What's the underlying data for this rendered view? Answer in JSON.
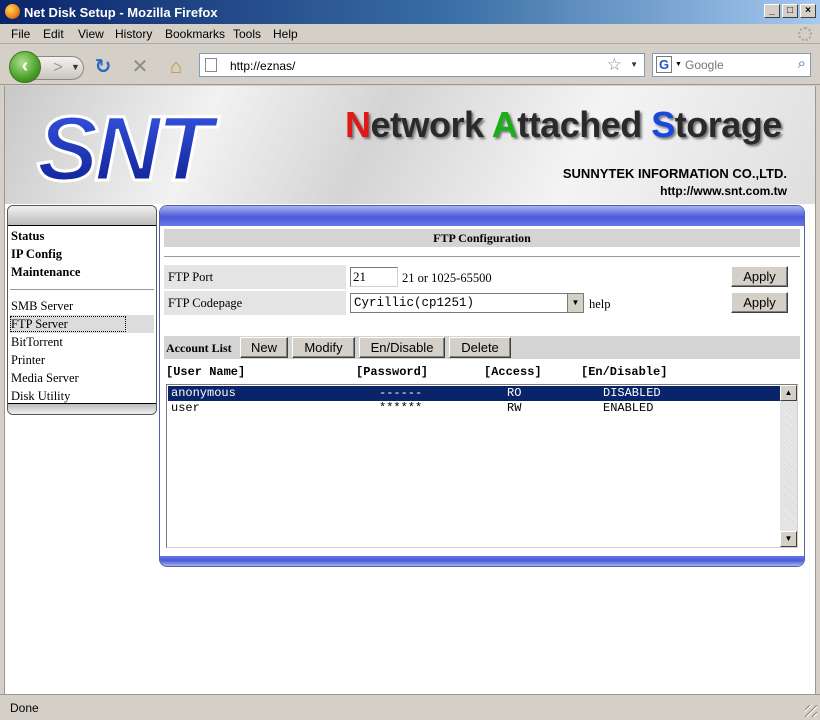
{
  "window": {
    "title": "Net Disk Setup - Mozilla Firefox"
  },
  "menubar": [
    "File",
    "Edit",
    "View",
    "History",
    "Bookmarks",
    "Tools",
    "Help"
  ],
  "navigation": {
    "url": "http://eznas/",
    "search_placeholder": "Google"
  },
  "banner": {
    "logo_text": "SNT",
    "heading": [
      "N",
      "etwork ",
      "A",
      "ttached ",
      "S",
      "torage"
    ],
    "company": "SUNNYTEK INFORMATION CO.,LTD.",
    "website": "http://www.snt.com.tw"
  },
  "sidebar": {
    "main_items": [
      "Status",
      "IP Config",
      "Maintenance"
    ],
    "service_items": [
      "SMB Server",
      "FTP Server",
      "BitTorrent",
      "Printer",
      "Media Server",
      "Disk Utility"
    ],
    "selected": "FTP Server"
  },
  "ftp": {
    "section_title": "FTP Configuration",
    "port_label": "FTP Port",
    "port_value": "21",
    "port_hint": "21 or 1025-65500",
    "codepage_label": "FTP Codepage",
    "codepage_value": "Cyrillic(cp1251)",
    "help_link": "help",
    "apply_label": "Apply"
  },
  "accounts": {
    "label": "Account List",
    "buttons": {
      "new": "New",
      "modify": "Modify",
      "endisable": "En/Disable",
      "delete": "Delete"
    },
    "columns": [
      "[User Name]",
      "[Password]",
      "[Access]",
      "[En/Disable]"
    ],
    "rows": [
      {
        "user": "anonymous",
        "password": "------",
        "access": "RO",
        "status": "DISABLED",
        "selected": true
      },
      {
        "user": "user",
        "password": "******",
        "access": "RW",
        "status": "ENABLED",
        "selected": false
      }
    ]
  },
  "status": {
    "text": "Done"
  },
  "colors": {
    "selection": "#0a246a",
    "panel_blue": "#4a5ad8",
    "title_gradient_start": "#0a246a"
  }
}
